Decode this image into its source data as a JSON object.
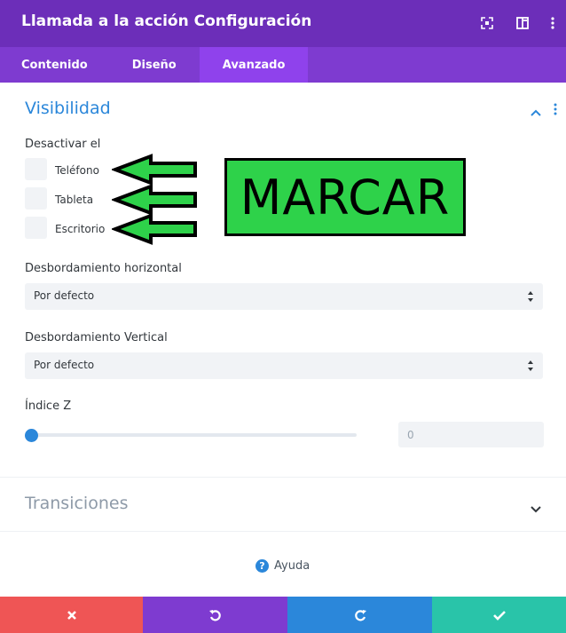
{
  "header": {
    "title": "Llamada a la acción Configuración",
    "icons": [
      "expand-icon",
      "sidebar-layout-icon",
      "more-vertical-icon"
    ]
  },
  "tabs": [
    {
      "label": "Contenido",
      "active": false
    },
    {
      "label": "Diseño",
      "active": false
    },
    {
      "label": "Avanzado",
      "active": true
    }
  ],
  "visibility": {
    "title": "Visibilidad",
    "disable_label": "Desactivar el",
    "options": [
      {
        "label": "Teléfono",
        "checked": false
      },
      {
        "label": "Tableta",
        "checked": false
      },
      {
        "label": "Escritorio",
        "checked": false
      }
    ],
    "overflow_h": {
      "label": "Desbordamiento horizontal",
      "value": "Por defecto"
    },
    "overflow_v": {
      "label": "Desbordamiento Vertical",
      "value": "Por defecto"
    },
    "z_index": {
      "label": "Índice Z",
      "value": "0",
      "slider_fraction": 0
    }
  },
  "transitions": {
    "title": "Transiciones"
  },
  "help": {
    "label": "Ayuda"
  },
  "annotation": {
    "text": "MARCAR"
  },
  "footer": {
    "buttons": [
      {
        "name": "cancel",
        "icon": "close-icon",
        "color": "#ef5555"
      },
      {
        "name": "undo",
        "icon": "undo-icon",
        "color": "#7e3bd0"
      },
      {
        "name": "redo",
        "icon": "redo-icon",
        "color": "#2b87da"
      },
      {
        "name": "save",
        "icon": "check-icon",
        "color": "#29c4a9"
      }
    ]
  },
  "colors": {
    "header": "#6c2eb9",
    "tabs": "#7e3bd0",
    "active_tab": "#8f42ec",
    "accent_blue": "#2b87da",
    "annotation_green": "#2ed24a"
  }
}
